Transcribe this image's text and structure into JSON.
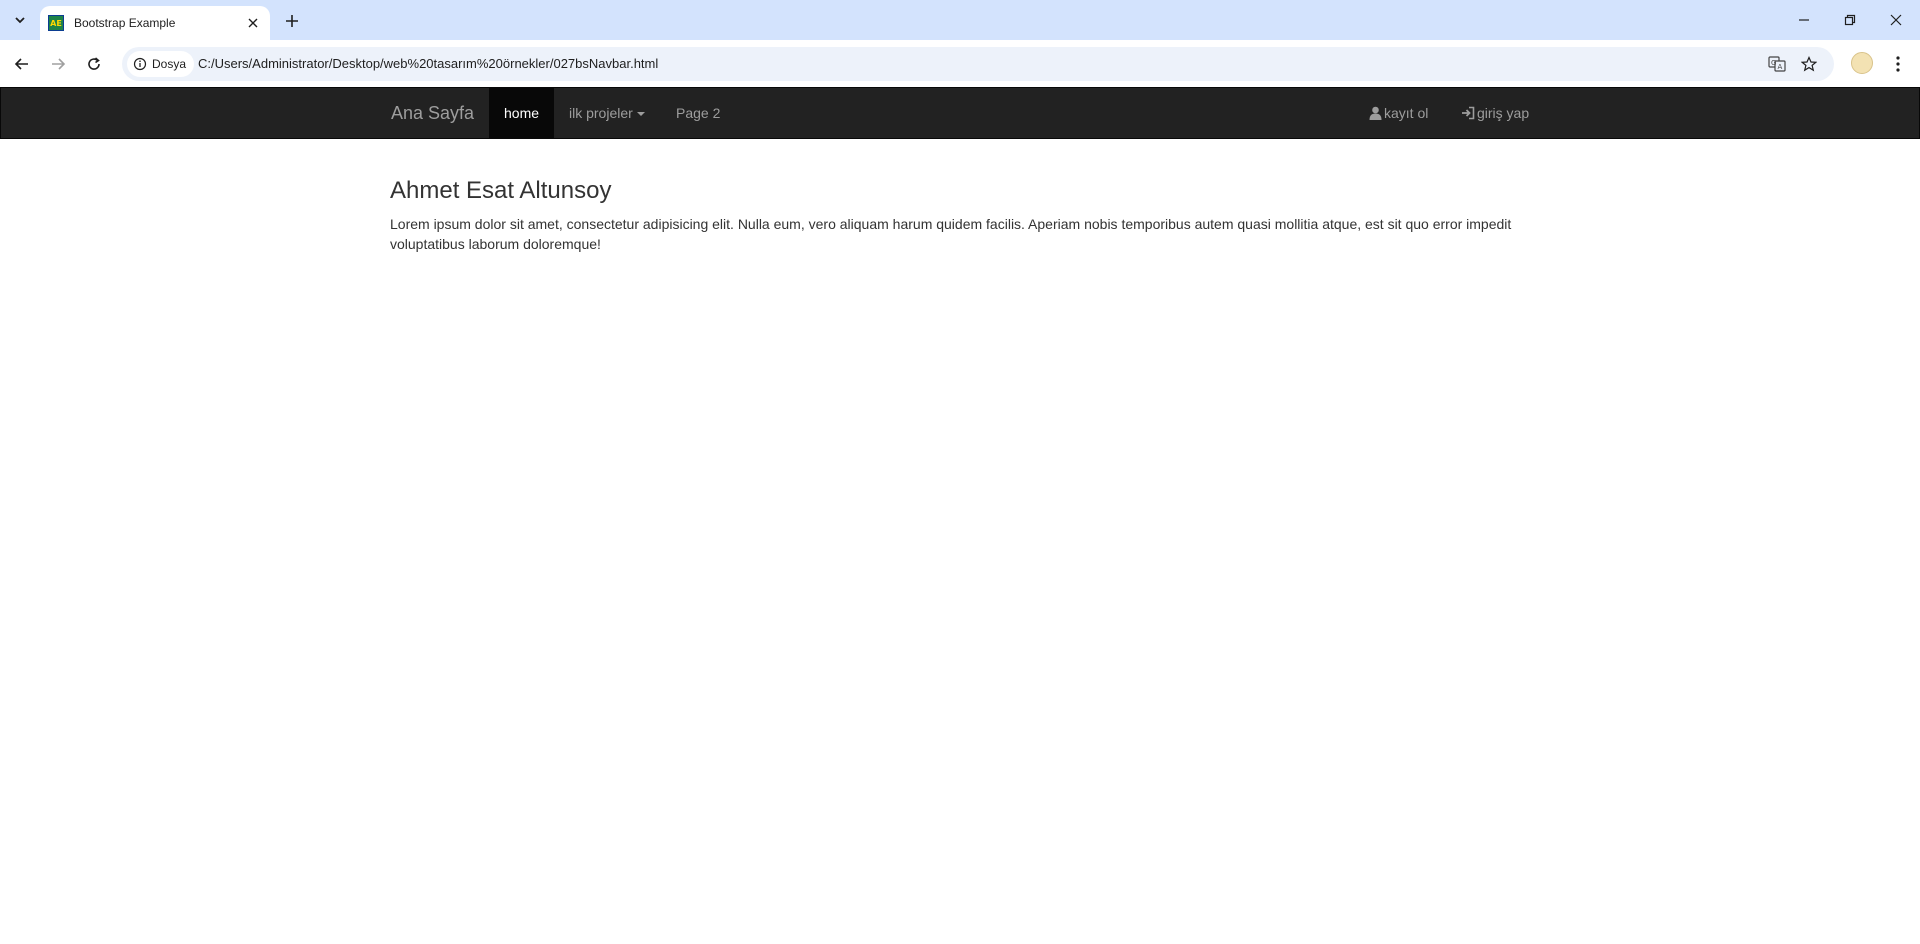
{
  "browser": {
    "tab_title": "Bootstrap Example",
    "favicon_text": "AE",
    "site_chip": "Dosya",
    "url": "C:/Users/Administrator/Desktop/web%20tasarım%20örnekler/027bsNavbar.html"
  },
  "navbar": {
    "brand": "Ana Sayfa",
    "items": [
      {
        "label": "home",
        "active": true
      },
      {
        "label": "ilk projeler",
        "dropdown": true
      },
      {
        "label": "Page 2"
      }
    ],
    "right_items": [
      {
        "label": "kayıt ol",
        "icon": "user-icon"
      },
      {
        "label": "giriş yap",
        "icon": "log-in-icon"
      }
    ],
    "colors": {
      "bg": "#222222",
      "active_bg": "#080808",
      "text": "#9d9d9d",
      "active_text": "#ffffff"
    }
  },
  "content": {
    "heading": "Ahmet Esat Altunsoy",
    "paragraph": "Lorem ipsum dolor sit amet, consectetur adipisicing elit. Nulla eum, vero aliquam harum quidem facilis. Aperiam nobis temporibus autem quasi mollitia atque, est sit quo error impedit voluptatibus laborum doloremque!"
  }
}
